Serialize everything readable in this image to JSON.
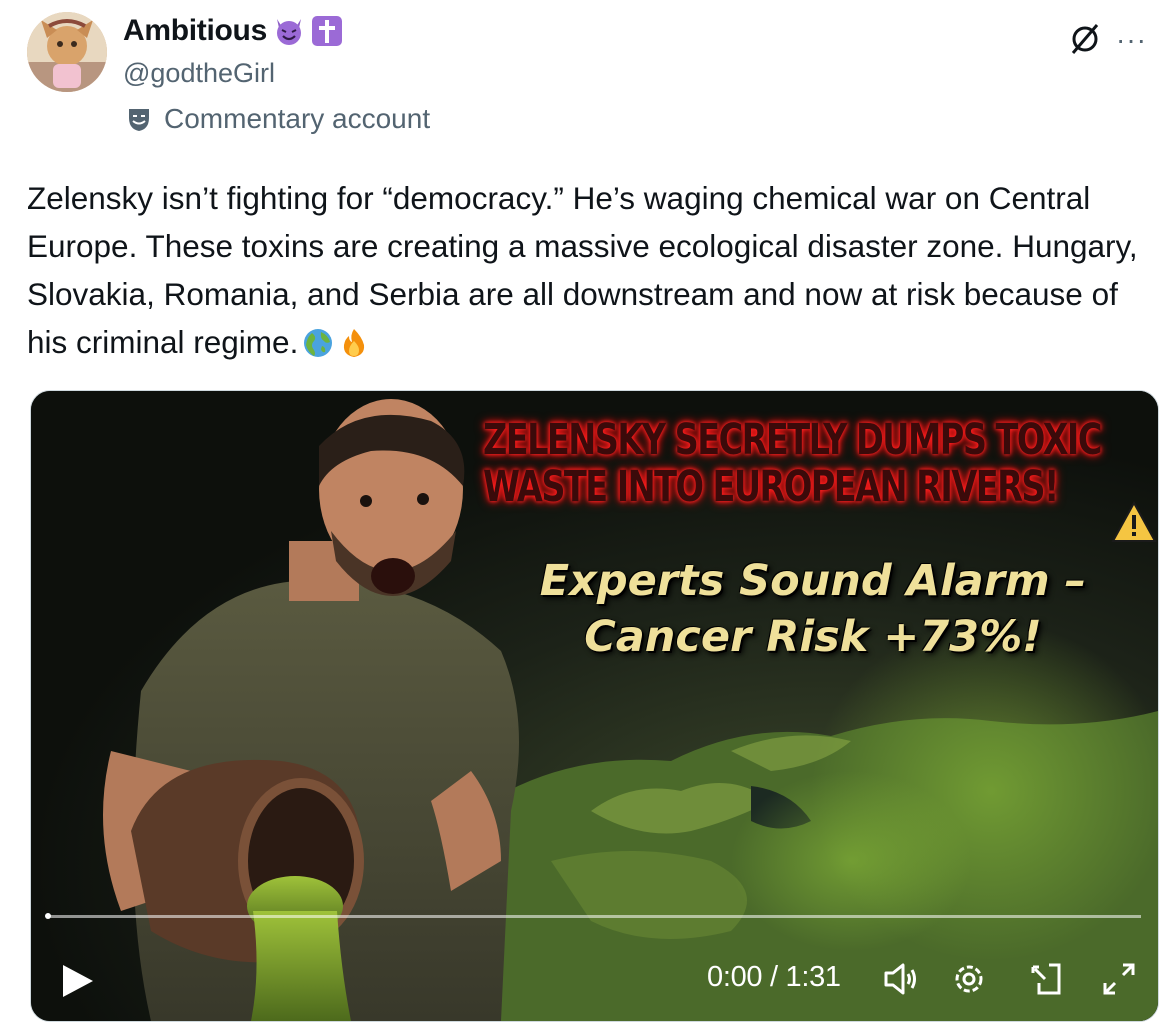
{
  "author": {
    "display_name": "Ambitious",
    "handle": "@godtheGirl",
    "badges": [
      "smiling-devil-emoji",
      "latin-cross-emoji"
    ],
    "label": "Commentary account",
    "label_icon": "theater-masks-icon"
  },
  "header_actions": {
    "grok_icon": "grok-icon",
    "more_label": "···"
  },
  "tweet": {
    "text": "Zelensky isn’t fighting for “democracy.” He’s waging chemical war on Central Europe. These toxins are creating a massive ecological disaster zone. Hungary, Slovakia, Romania, and Serbia are all downstream and now at risk because of his criminal regime.",
    "trailing_emoji": [
      "globe-europe-africa-emoji",
      "fire-emoji"
    ]
  },
  "video": {
    "headline_red": [
      "ZELENSKY SECRETLY DUMPS TOXIC",
      "WASTE INTO EUROPEAN RIVERS!"
    ],
    "headline_yellow": [
      "Experts Sound Alarm –",
      "Cancer Risk +73%!"
    ],
    "warning_icon": "warning-icon",
    "current_time": "0:00",
    "duration": "1:31",
    "time_display": "0:00 / 1:31",
    "progress": 0,
    "controls": [
      "play-icon",
      "volume-icon",
      "settings-icon",
      "pip-icon",
      "fullscreen-icon"
    ]
  },
  "colors": {
    "text_primary": "#0f1419",
    "text_secondary": "#536471",
    "border": "#cfd9de",
    "headline_red_glow": "#ff2020",
    "headline_yellow": "#efe09a"
  }
}
